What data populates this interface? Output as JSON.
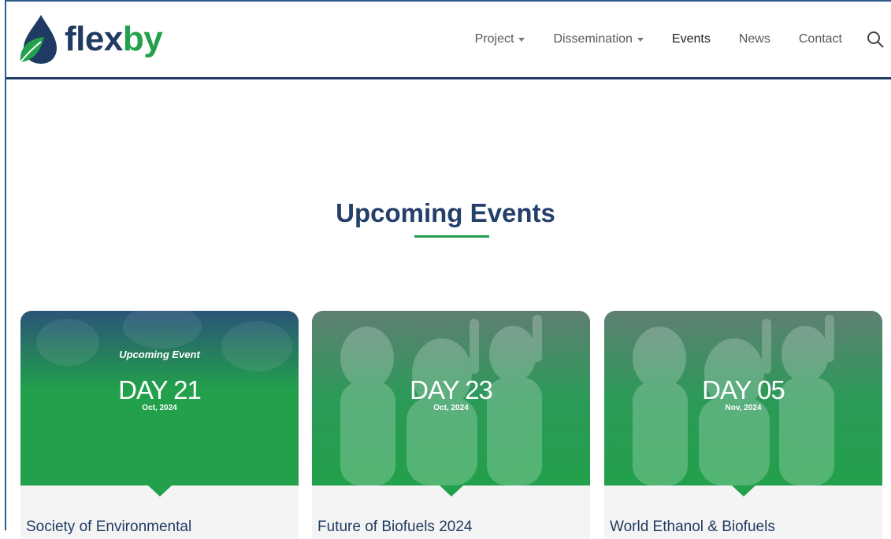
{
  "brand": {
    "name_part1": "flex",
    "name_part2": "by",
    "primary_color": "#1f3b63",
    "accent_color": "#22a04b"
  },
  "nav": {
    "items": [
      {
        "label": "Project",
        "dropdown": true
      },
      {
        "label": "Dissemination",
        "dropdown": true
      },
      {
        "label": "Events",
        "dropdown": false,
        "active": true
      },
      {
        "label": "News",
        "dropdown": false
      },
      {
        "label": "Contact",
        "dropdown": false
      }
    ],
    "search_icon": "search-icon"
  },
  "section": {
    "title": "Upcoming Events"
  },
  "events": [
    {
      "tag": "Upcoming Event",
      "day": "DAY 21",
      "date": "Oct, 2024",
      "title": "Society of Environmental"
    },
    {
      "tag": "",
      "day": "DAY 23",
      "date": "Oct, 2024",
      "title": "Future of Biofuels 2024"
    },
    {
      "tag": "",
      "day": "DAY 05",
      "date": "Nov, 2024",
      "title": "World Ethanol & Biofuels"
    }
  ]
}
